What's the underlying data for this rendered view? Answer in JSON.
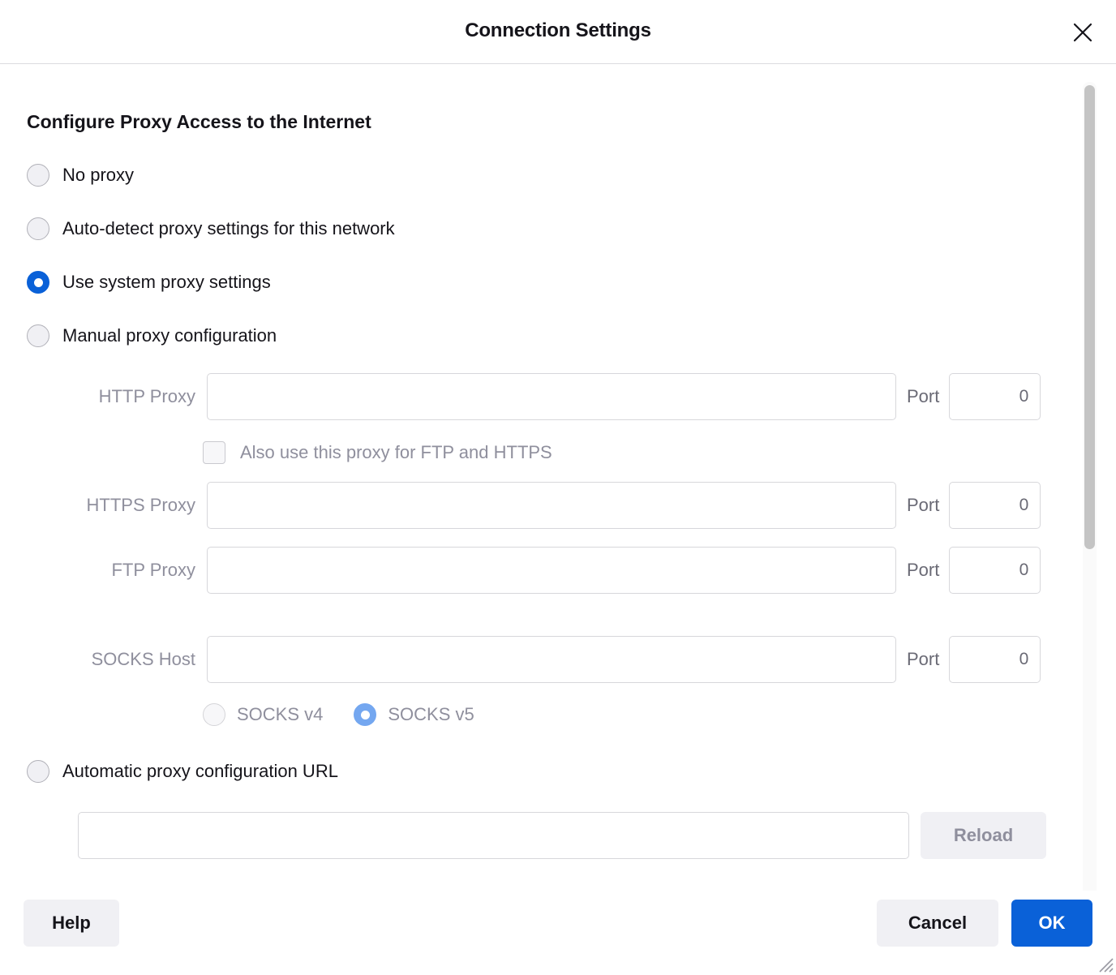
{
  "window": {
    "title": "Connection Settings",
    "close_icon": "close-icon"
  },
  "main": {
    "section_title": "Configure Proxy Access to the Internet",
    "proxy_modes": [
      {
        "label": "No proxy",
        "selected": false
      },
      {
        "label": "Auto-detect proxy settings for this network",
        "selected": false
      },
      {
        "label": "Use system proxy settings",
        "selected": true
      },
      {
        "label": "Manual proxy configuration",
        "selected": false
      },
      {
        "label": "Automatic proxy configuration URL",
        "selected": false
      }
    ],
    "manual": {
      "http": {
        "label": "HTTP Proxy",
        "value": "",
        "port_label": "Port",
        "port_value": "0"
      },
      "share_checkbox": {
        "label": "Also use this proxy for FTP and HTTPS",
        "checked": false
      },
      "https": {
        "label": "HTTPS Proxy",
        "value": "",
        "port_label": "Port",
        "port_value": "0"
      },
      "ftp": {
        "label": "FTP Proxy",
        "value": "",
        "port_label": "Port",
        "port_value": "0"
      },
      "socks": {
        "label": "SOCKS Host",
        "value": "",
        "port_label": "Port",
        "port_value": "0"
      },
      "socks_versions": [
        {
          "label": "SOCKS v4",
          "selected": false
        },
        {
          "label": "SOCKS v5",
          "selected": true
        }
      ]
    },
    "pac": {
      "url_value": "",
      "reload_label": "Reload"
    }
  },
  "footer": {
    "help_label": "Help",
    "cancel_label": "Cancel",
    "ok_label": "OK"
  },
  "colors": {
    "accent": "#0a61d8",
    "accent_dim": "#74a7f0",
    "text": "#15141a",
    "text_disabled": "#8f8f9d",
    "neutral_button": "#f0f0f4"
  }
}
